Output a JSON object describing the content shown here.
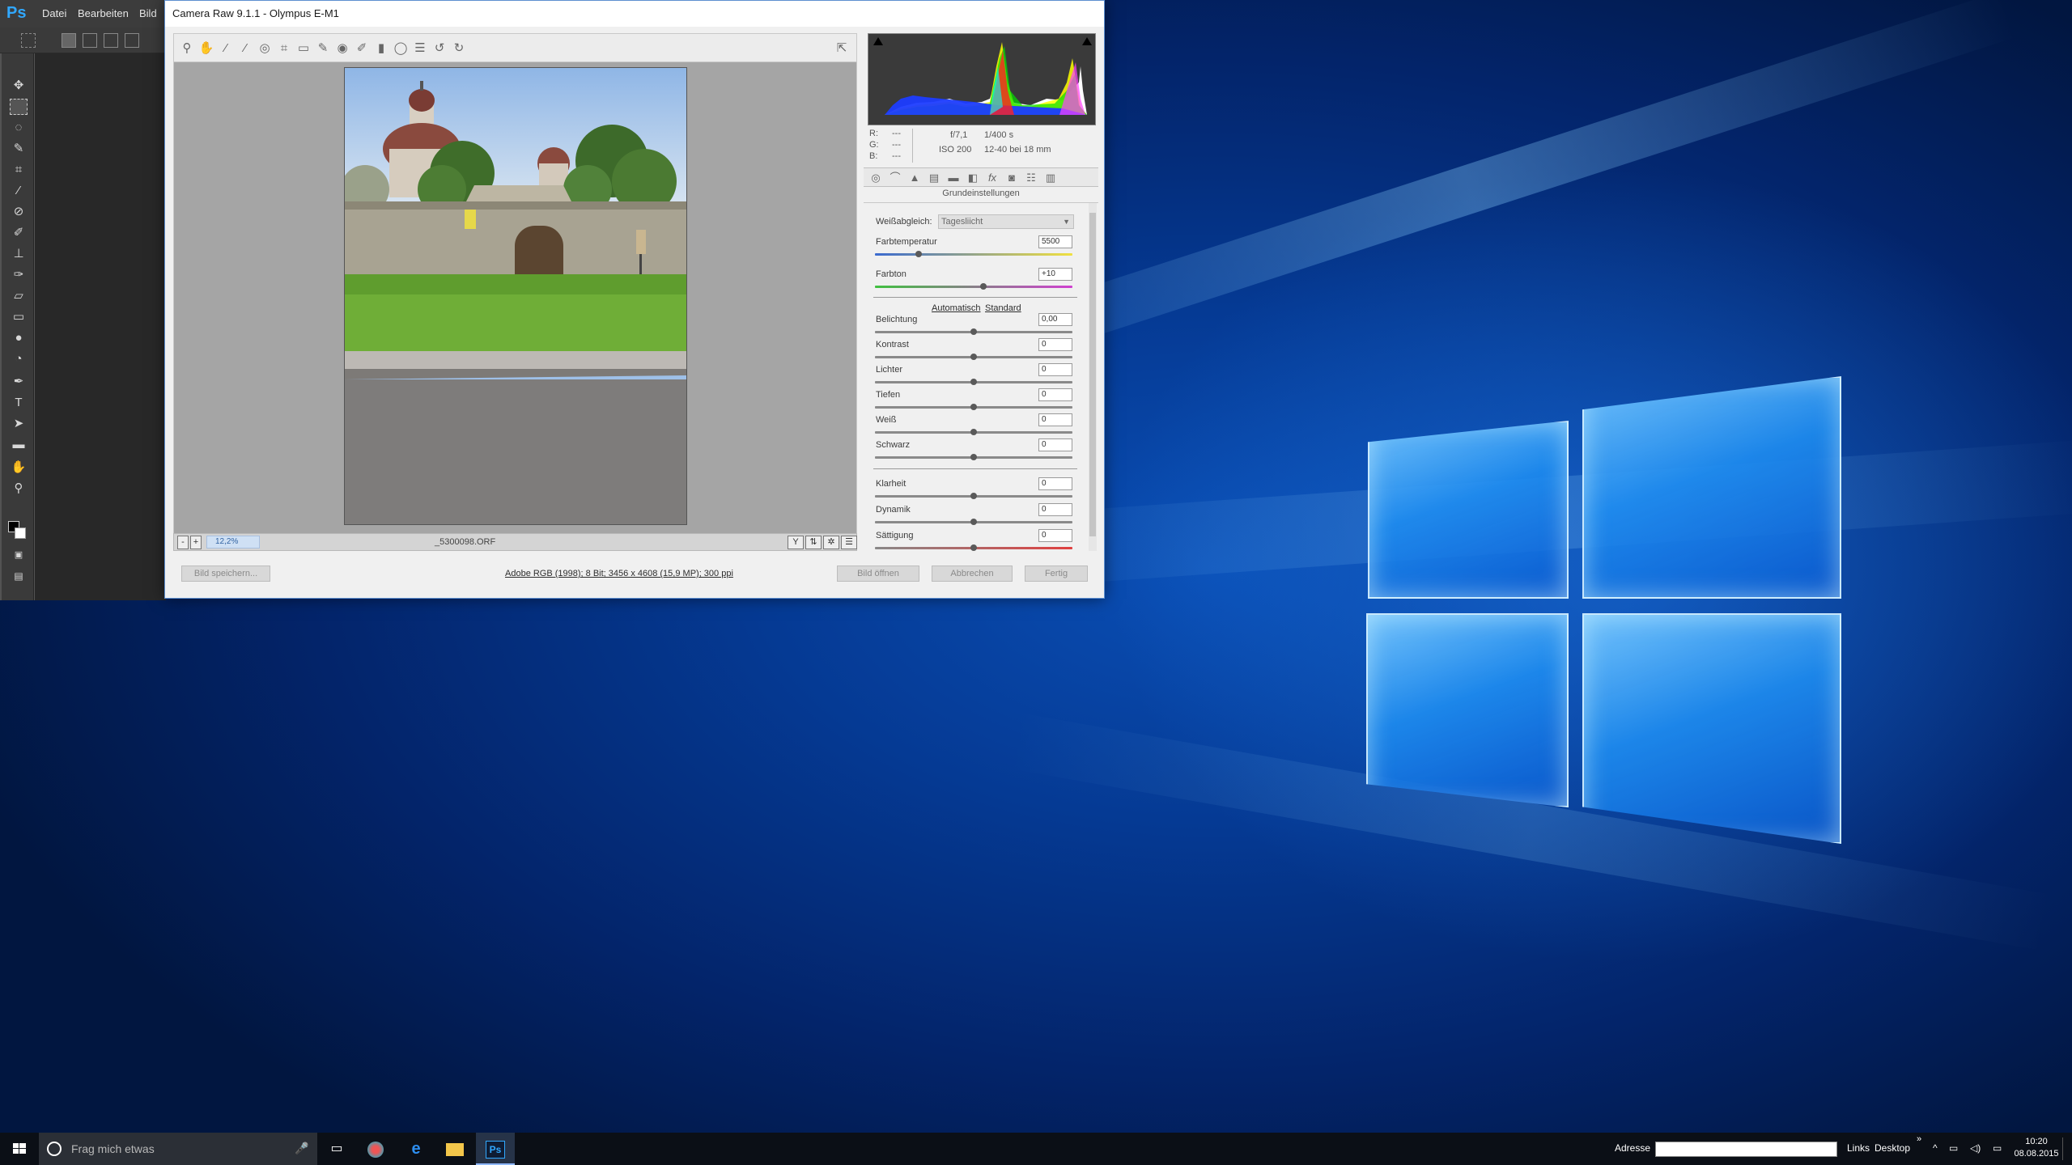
{
  "photoshop": {
    "logo": "Ps",
    "menu": [
      "Datei",
      "Bearbeiten",
      "Bild"
    ]
  },
  "acr": {
    "title": "Camera Raw 9.1.1  -  Olympus E-M1",
    "filename": "_5300098.ORF",
    "zoom": "12,2%",
    "exif": {
      "r_label": "R:",
      "g_label": "G:",
      "b_label": "B:",
      "r_value": "---",
      "g_value": "---",
      "b_value": "---",
      "aperture": "f/7,1",
      "shutter": "1/400 s",
      "iso": "ISO 200",
      "lens": "12-40 bei 18 mm"
    },
    "panel_title": "Grundeinstellungen",
    "white_balance": {
      "label": "Weißabgleich:",
      "value": "Tagesliicht"
    },
    "auto_link": "Automatisch",
    "standard_link": "Standard",
    "sliders": [
      {
        "label": "Farbtemperatur",
        "value": "5500",
        "level": 0.22
      },
      {
        "label": "Farbton",
        "value": "+10",
        "level": 0.55
      },
      {
        "label": "Belichtung",
        "value": "0,00",
        "level": 0.5
      },
      {
        "label": "Kontrast",
        "value": "0",
        "level": 0.5
      },
      {
        "label": "Lichter",
        "value": "0",
        "level": 0.5
      },
      {
        "label": "Tiefen",
        "value": "0",
        "level": 0.5
      },
      {
        "label": "Weiß",
        "value": "0",
        "level": 0.5
      },
      {
        "label": "Schwarz",
        "value": "0",
        "level": 0.5
      },
      {
        "label": "Klarheit",
        "value": "0",
        "level": 0.5
      },
      {
        "label": "Dynamik",
        "value": "0",
        "level": 0.5
      },
      {
        "label": "Sättigung",
        "value": "0",
        "level": 0.5
      }
    ],
    "buttons": {
      "save": "Bild speichern...",
      "open": "Bild öffnen",
      "cancel": "Abbrechen",
      "done": "Fertig"
    },
    "workflow": "Adobe RGB (1998); 8 Bit; 3456 x 4608 (15,9 MP); 300 ppi"
  },
  "taskbar": {
    "search_placeholder": "Frag mich etwas",
    "address_label": "Adresse",
    "links": "Links",
    "desktop": "Desktop",
    "time": "10:20",
    "date": "08.08.2015"
  }
}
